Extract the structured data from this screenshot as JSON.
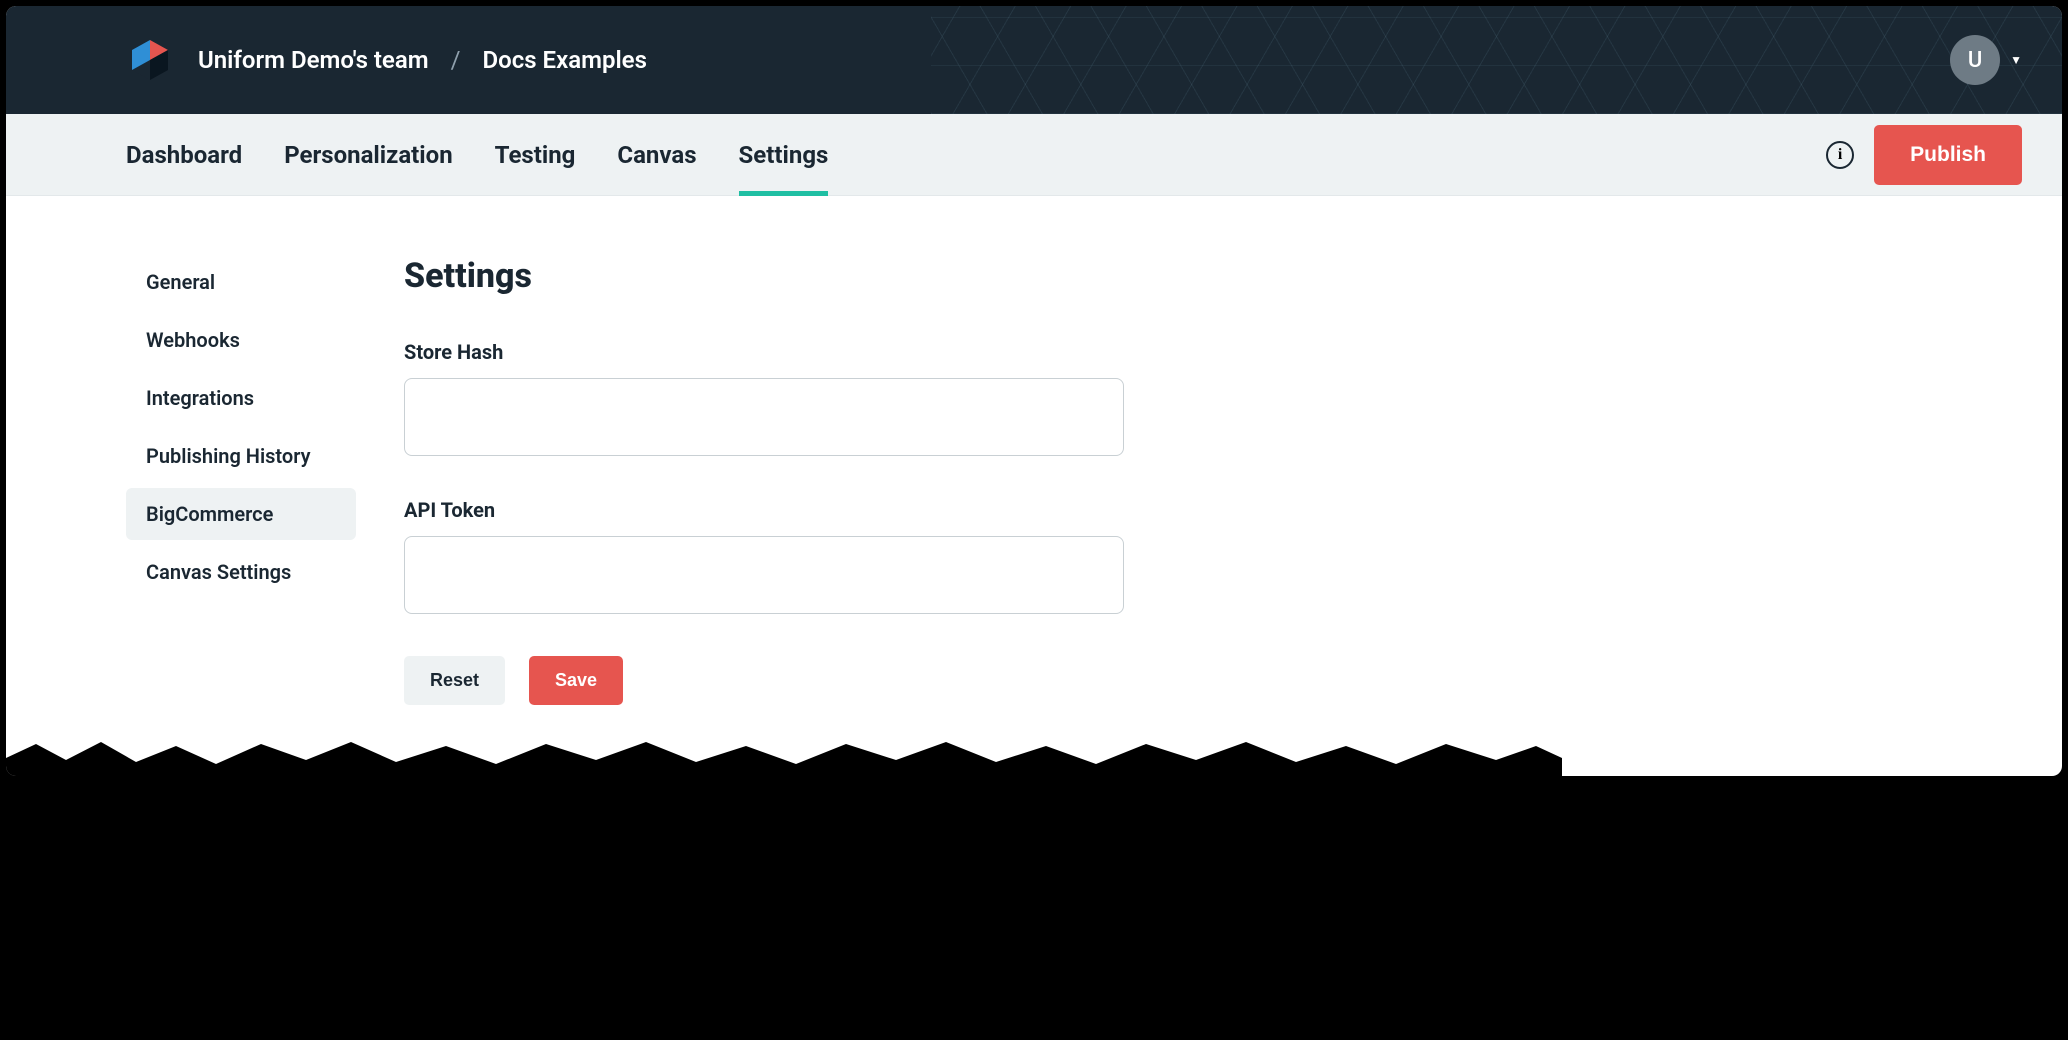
{
  "header": {
    "team_name": "Uniform Demo's team",
    "project_name": "Docs Examples",
    "separator": "/",
    "avatar_initial": "U"
  },
  "nav": {
    "tabs": [
      {
        "label": "Dashboard",
        "active": false
      },
      {
        "label": "Personalization",
        "active": false
      },
      {
        "label": "Testing",
        "active": false
      },
      {
        "label": "Canvas",
        "active": false
      },
      {
        "label": "Settings",
        "active": true
      }
    ],
    "publish_label": "Publish"
  },
  "sidebar": {
    "items": [
      {
        "label": "General",
        "active": false
      },
      {
        "label": "Webhooks",
        "active": false
      },
      {
        "label": "Integrations",
        "active": false
      },
      {
        "label": "Publishing History",
        "active": false
      },
      {
        "label": "BigCommerce",
        "active": true
      },
      {
        "label": "Canvas Settings",
        "active": false
      }
    ]
  },
  "page": {
    "title": "Settings",
    "fields": {
      "store_hash": {
        "label": "Store Hash",
        "value": "",
        "placeholder": ""
      },
      "api_token": {
        "label": "API Token",
        "value": "",
        "placeholder": ""
      }
    },
    "buttons": {
      "reset": "Reset",
      "save": "Save"
    }
  },
  "colors": {
    "accent": "#1fbfa3",
    "danger": "#e6554f",
    "dark": "#1a2732"
  }
}
